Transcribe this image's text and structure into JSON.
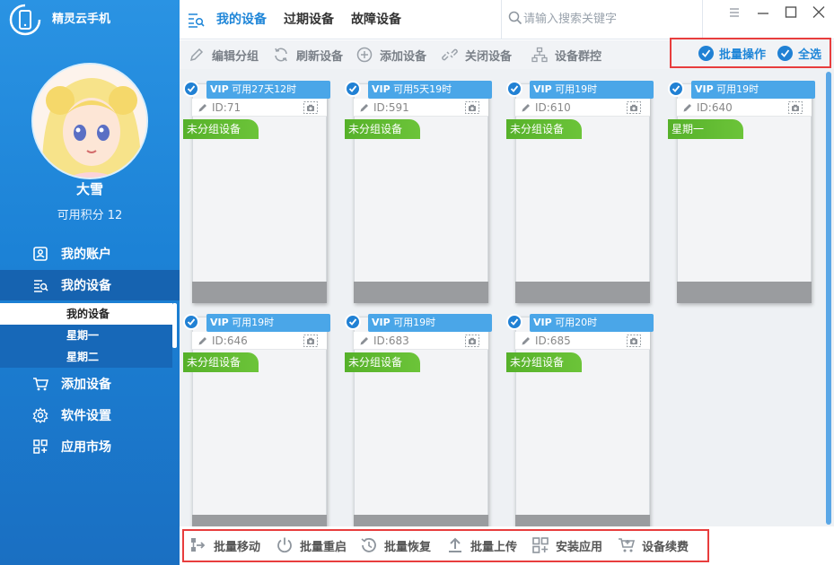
{
  "app": {
    "title": "精灵云手机"
  },
  "user": {
    "name": "大雪",
    "points": "可用积分 12"
  },
  "sidebar": {
    "items": [
      {
        "label": "我的账户",
        "icon": "account-icon"
      },
      {
        "label": "我的设备",
        "icon": "devices-icon"
      },
      {
        "label": "添加设备",
        "icon": "cart-icon"
      },
      {
        "label": "软件设置",
        "icon": "gear-icon"
      },
      {
        "label": "应用市场",
        "icon": "apps-icon"
      }
    ],
    "sub_items": [
      {
        "label": "我的设备"
      },
      {
        "label": "星期一"
      },
      {
        "label": "星期二"
      }
    ]
  },
  "header": {
    "tabs": [
      {
        "label": "我的设备"
      },
      {
        "label": "过期设备"
      },
      {
        "label": "故障设备"
      }
    ],
    "search_placeholder": "请输入搜索关键字"
  },
  "toolbar": {
    "edit_group": "编辑分组",
    "refresh": "刷新设备",
    "add": "添加设备",
    "close": "关闭设备",
    "group_control": "设备群控",
    "batch_op": "批量操作",
    "select_all": "全选",
    "tooltip": "全选"
  },
  "devices": [
    {
      "vip": "VIP",
      "remain": "可用27天12时",
      "id": "ID:71",
      "group": "未分组设备"
    },
    {
      "vip": "VIP",
      "remain": "可用5天19时",
      "id": "ID:591",
      "group": "未分组设备"
    },
    {
      "vip": "VIP",
      "remain": "可用19时",
      "id": "ID:610",
      "group": "未分组设备"
    },
    {
      "vip": "VIP",
      "remain": "可用19时",
      "id": "ID:640",
      "group": "星期一"
    },
    {
      "vip": "VIP",
      "remain": "可用19时",
      "id": "ID:646",
      "group": "未分组设备"
    },
    {
      "vip": "VIP",
      "remain": "可用19时",
      "id": "ID:683",
      "group": "未分组设备"
    },
    {
      "vip": "VIP",
      "remain": "可用20时",
      "id": "ID:685",
      "group": "未分组设备"
    }
  ],
  "bottom": {
    "move": "批量移动",
    "restart": "批量重启",
    "restore": "批量恢复",
    "upload": "批量上传",
    "install": "安装应用",
    "renew": "设备续费"
  },
  "colors": {
    "brand": "#1f86d8",
    "group_green": "#5cb531",
    "highlight": "#e83d3d"
  }
}
